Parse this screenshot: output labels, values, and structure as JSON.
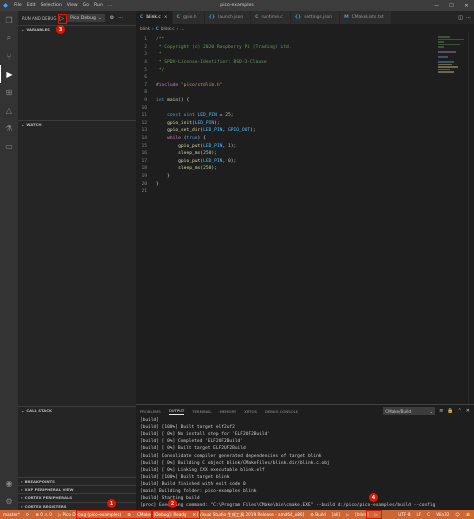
{
  "titlebar": {
    "menu": [
      "File",
      "Edit",
      "Selection",
      "View",
      "Go",
      "Run",
      "..."
    ],
    "title": "pico-examples"
  },
  "sidebar": {
    "header_title": "RUN AND DEBUG",
    "config": "Pico Debug",
    "sections": {
      "variables": "VARIABLES",
      "watch": "WATCH",
      "call_stack": "CALL STACK",
      "breakpoints": "BREAKPOINTS",
      "peripheral_view": "XXP PERIPHERAL VIEW",
      "cortex_peripherals": "CORTEX PERIPHERALS",
      "cortex_registers": "CORTEX REGISTERS"
    }
  },
  "tabs": [
    {
      "name": "blink.c",
      "icon": "C",
      "active": true
    },
    {
      "name": "gpio.h",
      "icon": "C",
      "active": false
    },
    {
      "name": "launch.json",
      "icon": "{}",
      "active": false
    },
    {
      "name": "runtime.c",
      "icon": "C",
      "active": false
    },
    {
      "name": "settings.json",
      "icon": "{}",
      "active": false
    },
    {
      "name": "CMakeLists.txt",
      "icon": "M",
      "active": false
    }
  ],
  "breadcrumb": [
    "blink",
    "C",
    "blink.c",
    "..."
  ],
  "editor": {
    "lines": [
      {
        "n": "1",
        "parts": [
          [
            "cm",
            "/**"
          ]
        ]
      },
      {
        "n": "2",
        "parts": [
          [
            "cm",
            " * Copyright (c) 2020 Raspberry Pi (Trading) Ltd."
          ]
        ]
      },
      {
        "n": "3",
        "parts": [
          [
            "cm",
            " *"
          ]
        ]
      },
      {
        "n": "4",
        "parts": [
          [
            "cm",
            " * SPDX-License-Identifier: BSD-3-Clause"
          ]
        ]
      },
      {
        "n": "5",
        "parts": [
          [
            "cm",
            " */"
          ]
        ]
      },
      {
        "n": "6",
        "parts": []
      },
      {
        "n": "7",
        "parts": [
          [
            "pp",
            "#include "
          ],
          [
            "ppv",
            "\"pico/stdlib.h\""
          ]
        ]
      },
      {
        "n": "8",
        "parts": []
      },
      {
        "n": "9",
        "parts": [
          [
            "kw",
            "int "
          ],
          [
            "fn",
            "main"
          ],
          [
            "pl",
            "() {"
          ]
        ]
      },
      {
        "n": "10",
        "parts": []
      },
      {
        "n": "11",
        "parts": [
          [
            "pl",
            "    "
          ],
          [
            "kw",
            "const uint "
          ],
          [
            "cst",
            "LED_PIN"
          ],
          [
            "pl",
            " = "
          ],
          [
            "num",
            "25"
          ],
          [
            "pl",
            ";"
          ]
        ]
      },
      {
        "n": "12",
        "parts": [
          [
            "pl",
            "    "
          ],
          [
            "fn",
            "gpio_init"
          ],
          [
            "pl",
            "("
          ],
          [
            "cst",
            "LED_PIN"
          ],
          [
            "pl",
            ");"
          ]
        ]
      },
      {
        "n": "13",
        "parts": [
          [
            "pl",
            "    "
          ],
          [
            "fn",
            "gpio_set_dir"
          ],
          [
            "pl",
            "("
          ],
          [
            "cst",
            "LED_PIN"
          ],
          [
            "pl",
            ", "
          ],
          [
            "cst",
            "GPIO_OUT"
          ],
          [
            "pl",
            ");"
          ]
        ]
      },
      {
        "n": "14",
        "parts": [
          [
            "pl",
            "    "
          ],
          [
            "ctl",
            "while "
          ],
          [
            "pl",
            "("
          ],
          [
            "kw",
            "true"
          ],
          [
            "pl",
            ") {"
          ]
        ]
      },
      {
        "n": "15",
        "parts": [
          [
            "pl",
            "        "
          ],
          [
            "fn",
            "gpio_put"
          ],
          [
            "pl",
            "("
          ],
          [
            "cst",
            "LED_PIN"
          ],
          [
            "pl",
            ", "
          ],
          [
            "num",
            "1"
          ],
          [
            "pl",
            ");"
          ]
        ]
      },
      {
        "n": "16",
        "parts": [
          [
            "pl",
            "        "
          ],
          [
            "fn",
            "sleep_ms"
          ],
          [
            "pl",
            "("
          ],
          [
            "num",
            "250"
          ],
          [
            "pl",
            ");"
          ]
        ]
      },
      {
        "n": "17",
        "parts": [
          [
            "pl",
            "        "
          ],
          [
            "fn",
            "gpio_put"
          ],
          [
            "pl",
            "("
          ],
          [
            "cst",
            "LED_PIN"
          ],
          [
            "pl",
            ", "
          ],
          [
            "num",
            "0"
          ],
          [
            "pl",
            ");"
          ]
        ]
      },
      {
        "n": "18",
        "parts": [
          [
            "pl",
            "        "
          ],
          [
            "fn",
            "sleep_ms"
          ],
          [
            "pl",
            "("
          ],
          [
            "num",
            "250"
          ],
          [
            "pl",
            ");"
          ]
        ]
      },
      {
        "n": "19",
        "parts": [
          [
            "pl",
            "    }"
          ]
        ]
      },
      {
        "n": "20",
        "parts": [
          [
            "pl",
            "}"
          ]
        ]
      },
      {
        "n": "21",
        "parts": []
      }
    ]
  },
  "panel": {
    "tabs": [
      "PROBLEMS",
      "OUTPUT",
      "TERMINAL",
      "MEMORY",
      "XRTOS",
      "DEBUG CONSOLE"
    ],
    "active_tab": "OUTPUT",
    "output_channel": "CMake/Build",
    "output_lines": [
      "[build]",
      "[build] [100%] Built target elf2uf2",
      "[build] [ 0%] No install step for 'ELF2UF2Build'",
      "[build] [ 0%] Completed 'ELF2UF2Build'",
      "[build] [ 0%] Built target ELF2UF2Build",
      "[build] Consolidate compiler generated dependencies of target blink",
      "[build] [ 0%] Building C object blink/CMakeFiles/blink.dir/blink.c.obj",
      "[build] [ 0%] Linking CXX executable blink.elf",
      "[build] [100%] Built target blink",
      "[build] Build finished with exit code 0",
      "[main] Building folder: pico-examples blink",
      "[build] Starting build",
      "[proc] Executing command: \"C:\\Program Files\\CMake\\bin\\cmake.EXE\" --build d:/pico/pico-examples/build --config"
    ]
  },
  "statusbar": {
    "left": [
      "master*",
      "⟳",
      "⊗ 0 ⚠ 0",
      "▷ Pico Debug (pico-examples)",
      "⚙",
      "CMake: [Debug]: Ready",
      "✕ [Visual Studio 生成工具 2019 Release - amd64_x86]",
      "⚙ Build",
      "[all]",
      "▷",
      "[blink]",
      "▷"
    ],
    "right": [
      "UTF-8",
      "LF",
      "C",
      "Win32",
      "☺",
      "🔔"
    ]
  },
  "annotations": [
    "1",
    "2",
    "3",
    "4"
  ],
  "colors": {
    "statusbar": "#cc6633",
    "annotation": "#e51400",
    "active_tab": "#1e1e1e"
  }
}
